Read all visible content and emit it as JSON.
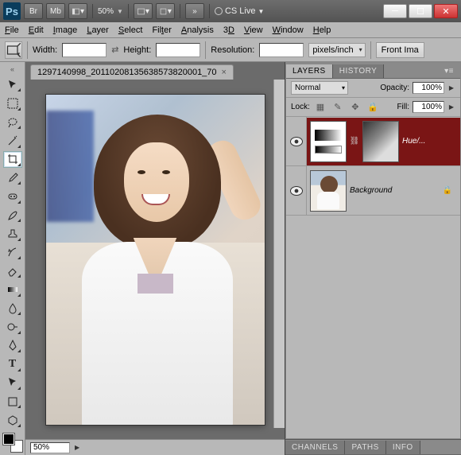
{
  "titlebar": {
    "logo": "Ps",
    "btn_br": "Br",
    "btn_mb": "Mb",
    "zoom": "50%",
    "cslive": "CS Live"
  },
  "menubar": {
    "items": [
      "File",
      "Edit",
      "Image",
      "Layer",
      "Select",
      "Filter",
      "Analysis",
      "3D",
      "View",
      "Window",
      "Help"
    ]
  },
  "optbar": {
    "width_label": "Width:",
    "width_value": "",
    "height_label": "Height:",
    "height_value": "",
    "res_label": "Resolution:",
    "res_value": "",
    "res_unit": "pixels/inch",
    "front_btn": "Front Ima"
  },
  "doc": {
    "tab_title": "1297140998_20110208135638573820001_70",
    "status_zoom": "50%"
  },
  "panels": {
    "layers_tab": "LAYERS",
    "history_tab": "HISTORY",
    "blend_mode": "Normal",
    "opacity_label": "Opacity:",
    "opacity_value": "100%",
    "lock_label": "Lock:",
    "fill_label": "Fill:",
    "fill_value": "100%",
    "layer1_name": "Hue/...",
    "layer2_name": "Background",
    "channels_tab": "CHANNELS",
    "paths_tab": "PATHS",
    "info_tab": "INFO"
  }
}
